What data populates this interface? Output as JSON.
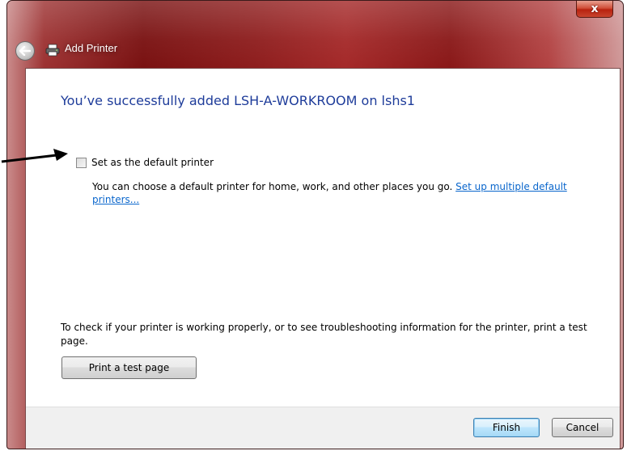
{
  "window": {
    "title": "Add Printer",
    "close_label": "x"
  },
  "main": {
    "heading": "You’ve successfully added LSH-A-WORKROOM on lshs1",
    "default_checkbox": {
      "label": "Set as the default printer",
      "checked": false
    },
    "description_text": "You can choose a default printer for home, work, and other places you go. ",
    "description_link": "Set up multiple default printers...",
    "troubleshoot_text": "To check if your printer is working properly, or to see troubleshooting information for the printer, print a test page.",
    "test_page_button": "Print a test page"
  },
  "footer": {
    "finish_label": "Finish",
    "cancel_label": "Cancel"
  },
  "colors": {
    "heading": "#1e3c9a",
    "link": "#0a66cc",
    "titlebar": "#8e1e1e"
  },
  "icons": {
    "back": "back-arrow-icon",
    "printer": "printer-icon",
    "close": "close-icon",
    "annotation": "arrow-annotation-icon"
  }
}
